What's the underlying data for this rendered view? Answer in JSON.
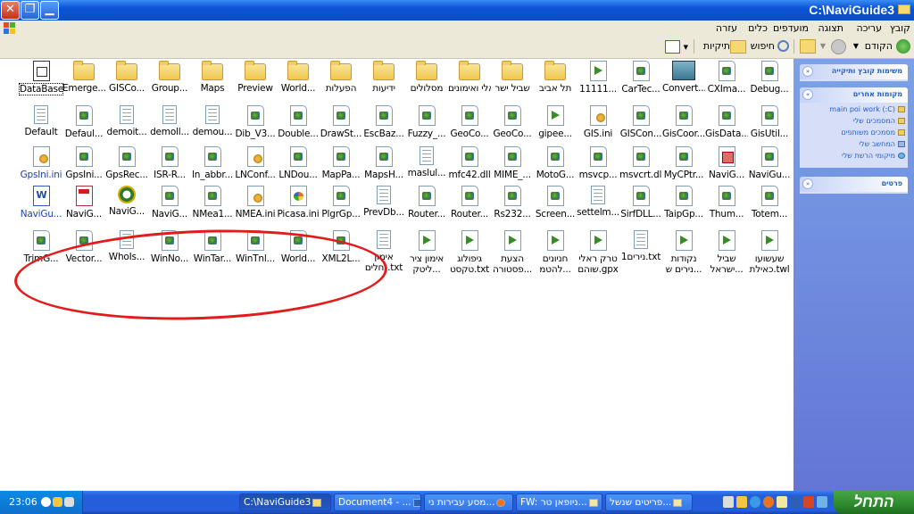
{
  "window": {
    "title": "C:\\NaviGuide3"
  },
  "menubar": {
    "items": [
      "קובץ",
      "עריכה",
      "תצוגה",
      "מועדפים",
      "כלים",
      "עזרה"
    ]
  },
  "toolbar": {
    "back": "הקודם",
    "search": "חיפוש",
    "folders": "תיקיות"
  },
  "icons_row1": [
    "Debug...",
    "CXIma...",
    "Convert...",
    "CarTec...",
    "11111...",
    "תל אביב",
    "שביל ישר",
    "ראלי ואימונים",
    "מסלולים",
    "ידיעות",
    "הפעלות",
    "World...",
    "Preview",
    "Maps",
    "Group...",
    "GISCo...",
    "Emerge...",
    "DataBase"
  ],
  "icons_row2": [
    "GisUtil...",
    "GisData...",
    "GisCoor...",
    "GISCon...",
    "GIS.ini",
    "gipee...",
    "GeoCo...",
    "GeoCo...",
    "Fuzzy_...",
    "EscBaz...",
    "DrawSt...",
    "Double...",
    "Dib_V3...",
    "demou...",
    "demoll...",
    "demoit...",
    "Defaul...",
    "Default"
  ],
  "icons_row3": [
    "NaviGu...",
    "NaviG...",
    "MyCPtr...",
    "msvcrt.dll",
    "msvcp...",
    "MotoG...",
    "MIME_...",
    "mfc42.dll",
    "maslul...",
    "MapsH...",
    "MapPa...",
    "LNDou...",
    "LNConf...",
    "ln_abbr...",
    "ISR-R...",
    "GpsRec...",
    "GpsIni...",
    "GpsIni.ini"
  ],
  "icons_row4": [
    "Totem...",
    "Thum...",
    "TaipGp...",
    "SirfDLL...",
    "settelm...",
    "Screen...",
    "Rs232...",
    "Router...",
    "Router...",
    "PrevDb...",
    "PlgrGp...",
    "Picasa.ini",
    "NMEA.ini",
    "NMea1...",
    "NaviG...",
    "NaviG...",
    "NaviG...",
    "NaviGu..."
  ],
  "icons_row5": [
    "שעשועו כאילת.twl",
    "שביל ישראל...",
    "נקודות נירים ש...",
    "1נירים.txt",
    "טרק ראלי שוהם.gpx",
    "חניונים להטמ...",
    "הצעת פסטורה...",
    "גיפולוג טקסט.txt",
    "אימון ציר ליטק...",
    "אימון נחלים.txt",
    "XML2L...",
    "World...",
    "WinTnl...",
    "WinTar...",
    "WinNo...",
    "WhoIs...",
    "Vector...",
    "TrimG..."
  ],
  "taskpane": {
    "file_tasks": "משימות קובץ ותיקייה",
    "other_places": "מקומות אחרים",
    "places": [
      "main poi work (:C)",
      "המסמכים שלי",
      "מסמכים משותפים",
      "המחשב שלי",
      "מיקומי הרשת שלי"
    ],
    "details": "פרטים"
  },
  "taskbar": {
    "start": "התחל",
    "clock": "23:06",
    "tasks": [
      "C:\\NaviGuide3",
      "Document4 - ...",
      "מסע עבירות ני...",
      "FW: ניופאן טר...",
      "פריטים שנשל..."
    ]
  },
  "colors": {
    "titlebar": "#0a53d6",
    "taskbar": "#245edb",
    "start": "#2d8a2d",
    "highlight": "#e21b1b"
  }
}
